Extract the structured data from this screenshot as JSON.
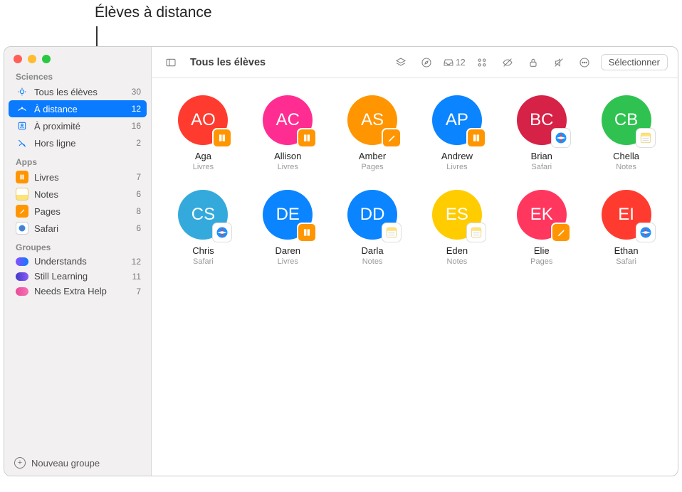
{
  "annotation": "Élèves à distance",
  "sidebar": {
    "sections": [
      {
        "header": "Sciences",
        "items": [
          {
            "label": "Tous les élèves",
            "count": "30"
          },
          {
            "label": "À distance",
            "count": "12"
          },
          {
            "label": "À proximité",
            "count": "16"
          },
          {
            "label": "Hors ligne",
            "count": "2"
          }
        ]
      },
      {
        "header": "Apps",
        "items": [
          {
            "label": "Livres",
            "count": "7"
          },
          {
            "label": "Notes",
            "count": "6"
          },
          {
            "label": "Pages",
            "count": "8"
          },
          {
            "label": "Safari",
            "count": "6"
          }
        ]
      },
      {
        "header": "Groupes",
        "items": [
          {
            "label": "Understands",
            "count": "12"
          },
          {
            "label": "Still Learning",
            "count": "11"
          },
          {
            "label": "Needs Extra Help",
            "count": "7"
          }
        ]
      }
    ],
    "footer": "Nouveau groupe"
  },
  "toolbar": {
    "title": "Tous les élèves",
    "inbox_count": "12",
    "select_label": "Sélectionner"
  },
  "students": [
    {
      "initials": "AO",
      "name": "Aga",
      "app": "Livres",
      "color": "c-red",
      "badge": "livres"
    },
    {
      "initials": "AC",
      "name": "Allison",
      "app": "Livres",
      "color": "c-pink",
      "badge": "livres"
    },
    {
      "initials": "AS",
      "name": "Amber",
      "app": "Pages",
      "color": "c-orange",
      "badge": "pages"
    },
    {
      "initials": "AP",
      "name": "Andrew",
      "app": "Livres",
      "color": "c-blue",
      "badge": "livres"
    },
    {
      "initials": "BC",
      "name": "Brian",
      "app": "Safari",
      "color": "c-darkred",
      "badge": "safari"
    },
    {
      "initials": "CB",
      "name": "Chella",
      "app": "Notes",
      "color": "c-green",
      "badge": "notes"
    },
    {
      "initials": "CS",
      "name": "Chris",
      "app": "Safari",
      "color": "c-lightblue",
      "badge": "safari"
    },
    {
      "initials": "DE",
      "name": "Daren",
      "app": "Livres",
      "color": "c-blue",
      "badge": "livres"
    },
    {
      "initials": "DD",
      "name": "Darla",
      "app": "Notes",
      "color": "c-blue",
      "badge": "notes"
    },
    {
      "initials": "ES",
      "name": "Eden",
      "app": "Notes",
      "color": "c-yellow",
      "badge": "notes"
    },
    {
      "initials": "EK",
      "name": "Elie",
      "app": "Pages",
      "color": "c-magenta",
      "badge": "pages"
    },
    {
      "initials": "EI",
      "name": "Ethan",
      "app": "Safari",
      "color": "c-red",
      "badge": "safari"
    }
  ]
}
